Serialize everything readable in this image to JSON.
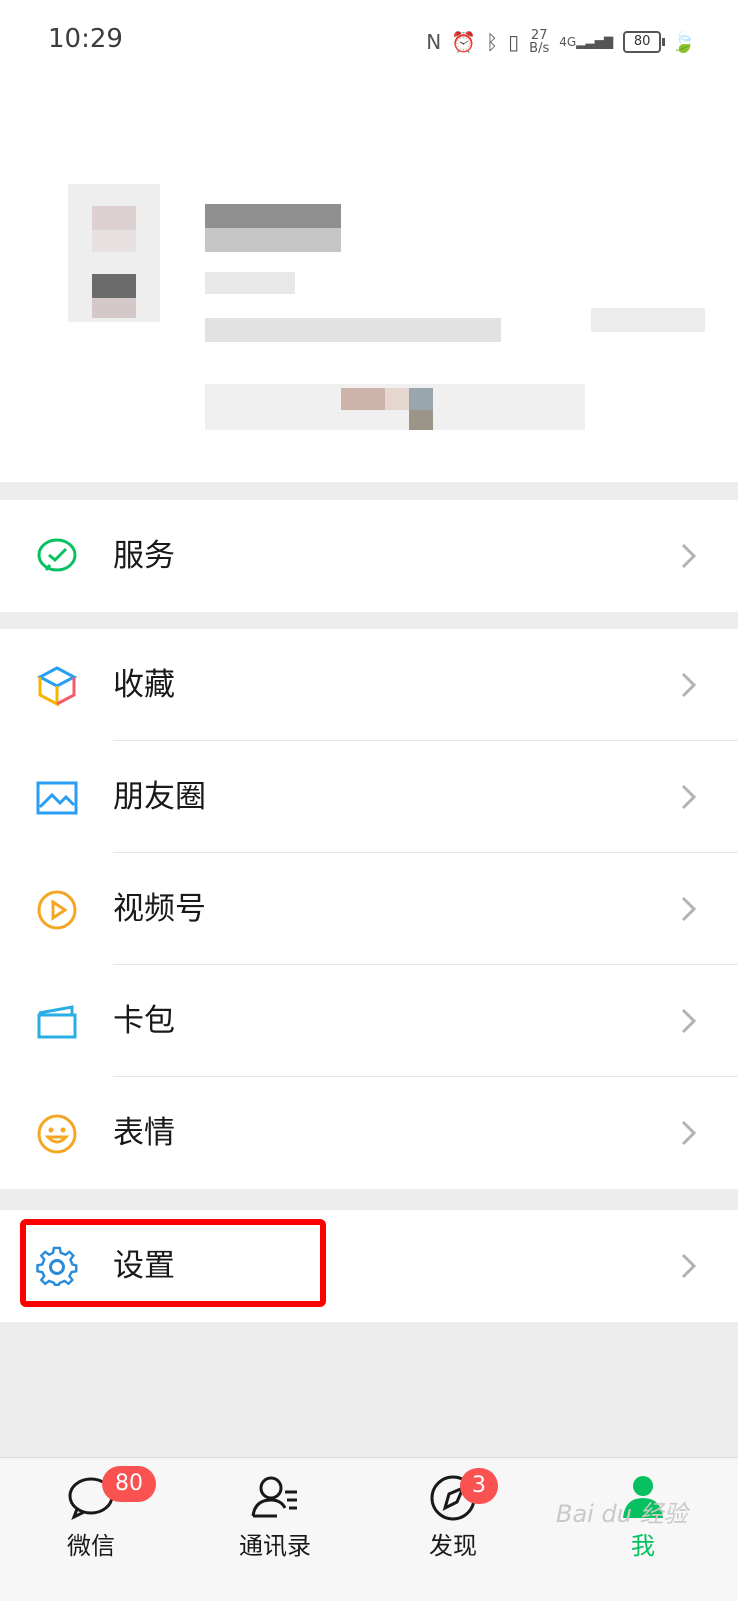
{
  "status_bar": {
    "time": "10:29",
    "net_speed_value": "27",
    "net_speed_unit": "B/s",
    "network": "4G",
    "battery": "80"
  },
  "menu": {
    "service": "服务",
    "favorites": "收藏",
    "moments": "朋友圈",
    "channels": "视频号",
    "cards": "卡包",
    "stickers": "表情",
    "settings": "设置"
  },
  "tabs": {
    "chats": "微信",
    "chats_badge": "80",
    "contacts": "通讯录",
    "discover": "发现",
    "discover_badge": "3",
    "me": "我"
  },
  "colors": {
    "accent": "#07c160",
    "badge": "#fa5151",
    "highlight": "#ff0000"
  },
  "watermark": "Bai du 经验"
}
